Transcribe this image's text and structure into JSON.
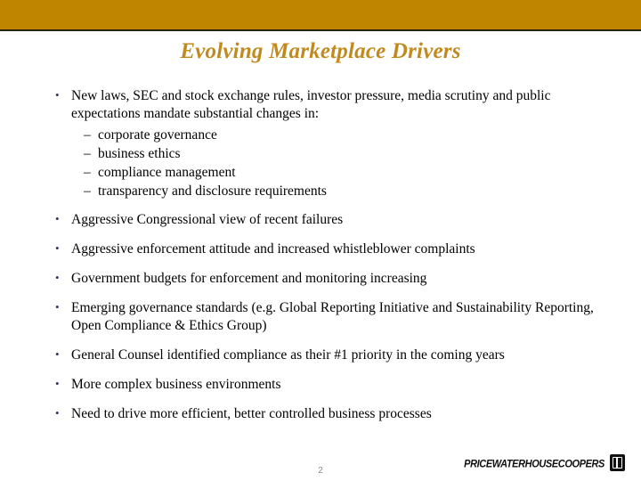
{
  "slide": {
    "title": "Evolving Marketplace Drivers",
    "banner_color": "#bf8500",
    "title_color": "#c08a1e",
    "bullet_color": "#333366",
    "background_color": "#ffffff",
    "bullets": [
      {
        "text": "New laws, SEC and stock exchange rules, investor pressure, media scrutiny and public expectations mandate substantial changes in:",
        "subitems": [
          "corporate governance",
          "business ethics",
          "compliance management",
          "transparency and disclosure requirements"
        ]
      },
      {
        "text": "Aggressive Congressional view of recent failures",
        "subitems": []
      },
      {
        "text": "Aggressive enforcement attitude and increased whistleblower complaints",
        "subitems": []
      },
      {
        "text": "Government budgets for enforcement and monitoring increasing",
        "subitems": []
      },
      {
        "text": "Emerging governance standards (e.g. Global Reporting Initiative and Sustainability Reporting, Open Compliance & Ethics Group)",
        "subitems": []
      },
      {
        "text": "General Counsel identified compliance as their #1 priority in the coming years",
        "subitems": []
      },
      {
        "text": "More complex business environments",
        "subitems": []
      },
      {
        "text": "Need to drive more efficient, better controlled business processes",
        "subitems": []
      }
    ]
  },
  "footer": {
    "page_number": "2",
    "logo_text": "PricewaterhouseCoopers",
    "logo_mark": "pwc-square-emblem-icon"
  }
}
